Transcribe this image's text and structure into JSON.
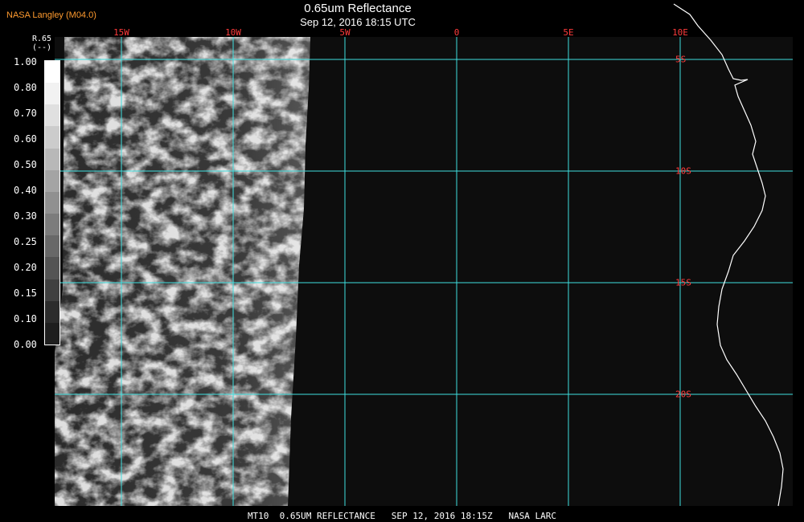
{
  "header": {
    "source": "NASA Langley (M04.0)",
    "title": "0.65um Reflectance",
    "timestamp": "Sep 12, 2016 18:15 UTC"
  },
  "grid": {
    "longitudes": [
      {
        "value": -15,
        "label": "15W"
      },
      {
        "value": -10,
        "label": "10W"
      },
      {
        "value": -5,
        "label": "5W"
      },
      {
        "value": 0,
        "label": "0"
      },
      {
        "value": 5,
        "label": "5E"
      },
      {
        "value": 10,
        "label": "10E"
      }
    ],
    "latitudes": [
      {
        "value": -5,
        "label": "5S"
      },
      {
        "value": -10,
        "label": "10S"
      },
      {
        "value": -15,
        "label": "15S"
      },
      {
        "value": -20,
        "label": "20S"
      }
    ],
    "line_color": "#3fe0e0",
    "label_color": "#ff3b3b"
  },
  "legend": {
    "name": "R.65",
    "unit": "(--)",
    "ticks": [
      "1.00",
      "0.80",
      "0.70",
      "0.60",
      "0.50",
      "0.40",
      "0.30",
      "0.25",
      "0.20",
      "0.15",
      "0.10",
      "0.00"
    ],
    "colors": [
      "#ffffff",
      "#f2f2f2",
      "#e0e0e0",
      "#cccccc",
      "#b8b8b8",
      "#a4a4a4",
      "#909090",
      "#7c7c7c",
      "#686868",
      "#545454",
      "#404040",
      "#2c2c2c",
      "#1e1e1e"
    ]
  },
  "footer": "MT10  0.65UM REFLECTANCE   SEP 12, 2016 18:15Z   NASA LARC",
  "colors": {
    "background": "#0d0d0d",
    "coastline": "#ffffff"
  }
}
